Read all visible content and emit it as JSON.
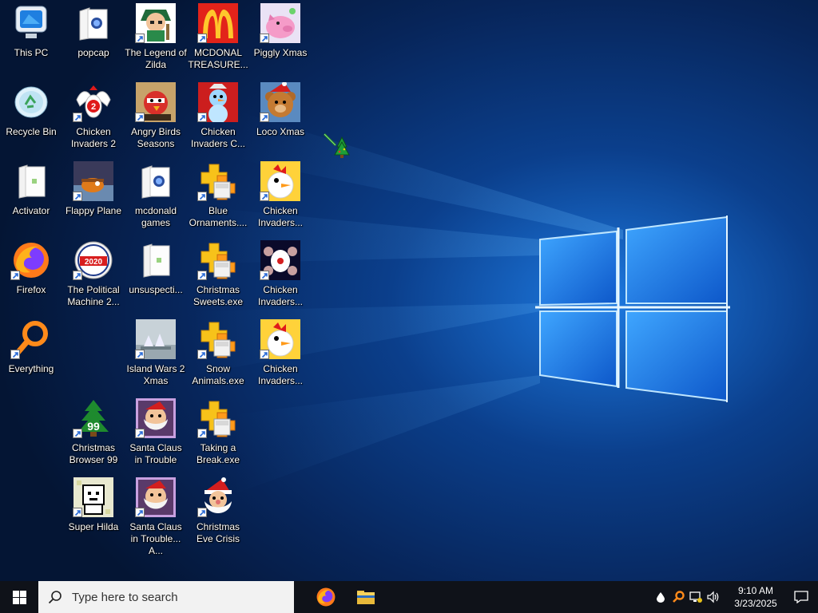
{
  "desktop": {
    "icons": [
      {
        "label": "This PC",
        "icon": "computer-icon",
        "shortcut": false
      },
      {
        "label": "popcap",
        "icon": "folder-icon",
        "shortcut": false
      },
      {
        "label": "The Legend of Zilda",
        "icon": "zilda-game-icon",
        "shortcut": true
      },
      {
        "label": "MCDONAL TREASURE...",
        "icon": "mcdonalds-icon",
        "shortcut": true
      },
      {
        "label": "Piggly Xmas",
        "icon": "pig-icon",
        "shortcut": true
      },
      {
        "label": "Recycle Bin",
        "icon": "recycle-bin-icon",
        "shortcut": false
      },
      {
        "label": "Chicken Invaders 2",
        "icon": "chicken-invaders-icon",
        "shortcut": true
      },
      {
        "label": "Angry Birds Seasons",
        "icon": "angry-birds-icon",
        "shortcut": true
      },
      {
        "label": "Chicken Invaders C...",
        "icon": "snowman-icon",
        "shortcut": true
      },
      {
        "label": "Loco Xmas",
        "icon": "bear-icon",
        "shortcut": true
      },
      {
        "label": "Activator",
        "icon": "file-icon",
        "shortcut": false
      },
      {
        "label": "Flappy Plane",
        "icon": "flappy-plane-icon",
        "shortcut": true
      },
      {
        "label": "mcdonald games",
        "icon": "folder-icon",
        "shortcut": false
      },
      {
        "label": "Blue Ornaments....",
        "icon": "puzzle-icon",
        "shortcut": true
      },
      {
        "label": "Chicken Invaders...",
        "icon": "chicken-icon",
        "shortcut": true
      },
      {
        "label": "Firefox",
        "icon": "firefox-icon",
        "shortcut": true
      },
      {
        "label": "The Political Machine 2...",
        "icon": "political-machine-icon",
        "shortcut": true
      },
      {
        "label": "unsuspecti...",
        "icon": "file-icon",
        "shortcut": false
      },
      {
        "label": "Christmas Sweets.exe",
        "icon": "puzzle-icon",
        "shortcut": true
      },
      {
        "label": "Chicken Invaders...",
        "icon": "chicken-space-icon",
        "shortcut": true
      },
      {
        "label": "Everything",
        "icon": "magnifier-icon",
        "shortcut": true
      },
      {
        "label": "Island Wars 2 Xmas",
        "icon": "island-icon",
        "shortcut": true
      },
      {
        "label": "Snow Animals.exe",
        "icon": "puzzle-icon",
        "shortcut": true
      },
      {
        "label": "Chicken Invaders...",
        "icon": "chicken-icon",
        "shortcut": true
      },
      {
        "label": "Christmas Browser 99",
        "icon": "christmas-tree-icon",
        "shortcut": true
      },
      {
        "label": "Santa Claus in Trouble",
        "icon": "santa-icon",
        "shortcut": true
      },
      {
        "label": "Taking a Break.exe",
        "icon": "puzzle-icon",
        "shortcut": true
      },
      {
        "label": "Super Hilda",
        "icon": "hilda-icon",
        "shortcut": true
      },
      {
        "label": "Santa Claus in Trouble... A...",
        "icon": "santa-icon",
        "shortcut": true
      },
      {
        "label": "Christmas Eve Crisis",
        "icon": "santa-face-icon",
        "shortcut": true
      }
    ]
  },
  "taskbar": {
    "search_placeholder": "Type here to search",
    "pinned": [
      {
        "name": "firefox-taskbar-button",
        "icon": "firefox-icon"
      },
      {
        "name": "file-explorer-taskbar-button",
        "icon": "file-explorer-icon"
      }
    ],
    "tray": {
      "icons": [
        "drop-icon",
        "search-tray-icon",
        "network-icon",
        "volume-icon"
      ],
      "time": "9:10 AM",
      "date": "3/23/2025"
    }
  },
  "colors": {
    "taskbar": "#0f1219",
    "wallpaper_light": "#4aa8ff",
    "wallpaper_dark": "#05152e"
  }
}
